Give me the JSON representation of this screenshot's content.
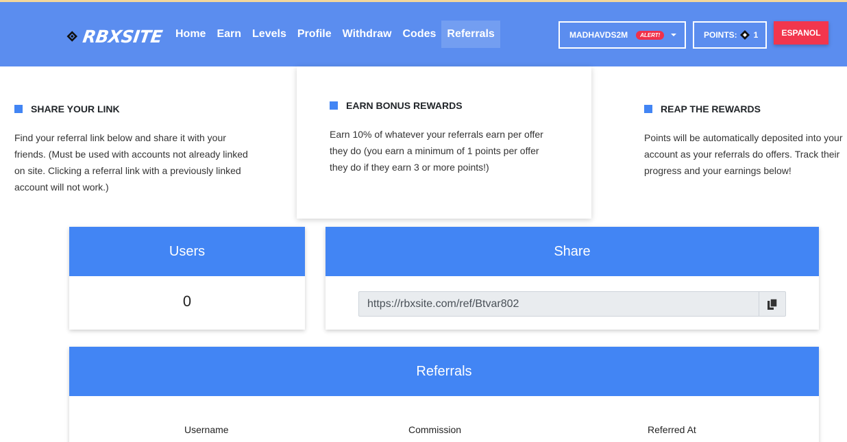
{
  "brand": {
    "name": "RBXSITE"
  },
  "nav": {
    "links": [
      "Home",
      "Earn",
      "Levels",
      "Profile",
      "Withdraw",
      "Codes",
      "Referrals"
    ],
    "active": "Referrals"
  },
  "user": {
    "username": "MADHAVDS2M",
    "alert": "ALERT!"
  },
  "points": {
    "label": "POINTS:",
    "value": "1"
  },
  "language_button": "ESPANOL",
  "info": {
    "share": {
      "title": "SHARE YOUR LINK",
      "text": "Find your referral link below and share it with your friends. (Must be used with accounts not already linked on site. Clicking a referral link with a previously linked account will not work.)"
    },
    "bonus": {
      "title": "EARN BONUS REWARDS",
      "text": "Earn 10% of whatever your referrals earn per offer they do (you earn a minimum of 1 points per offer they do if they earn 3 or more points!)"
    },
    "reap": {
      "title": "REAP THE REWARDS",
      "text": "Points will be automatically deposited into your account as your referrals do offers. Track their progress and your earnings below!"
    }
  },
  "users_card": {
    "title": "Users",
    "value": "0"
  },
  "share_card": {
    "title": "Share",
    "link": "https://rbxsite.com/ref/Btvar802"
  },
  "referrals_card": {
    "title": "Referrals",
    "columns": [
      "Username",
      "Commission",
      "Referred At"
    ]
  },
  "colors": {
    "nav_bg": "#5b8def",
    "accent": "#4285f4",
    "danger": "#f2364d"
  }
}
